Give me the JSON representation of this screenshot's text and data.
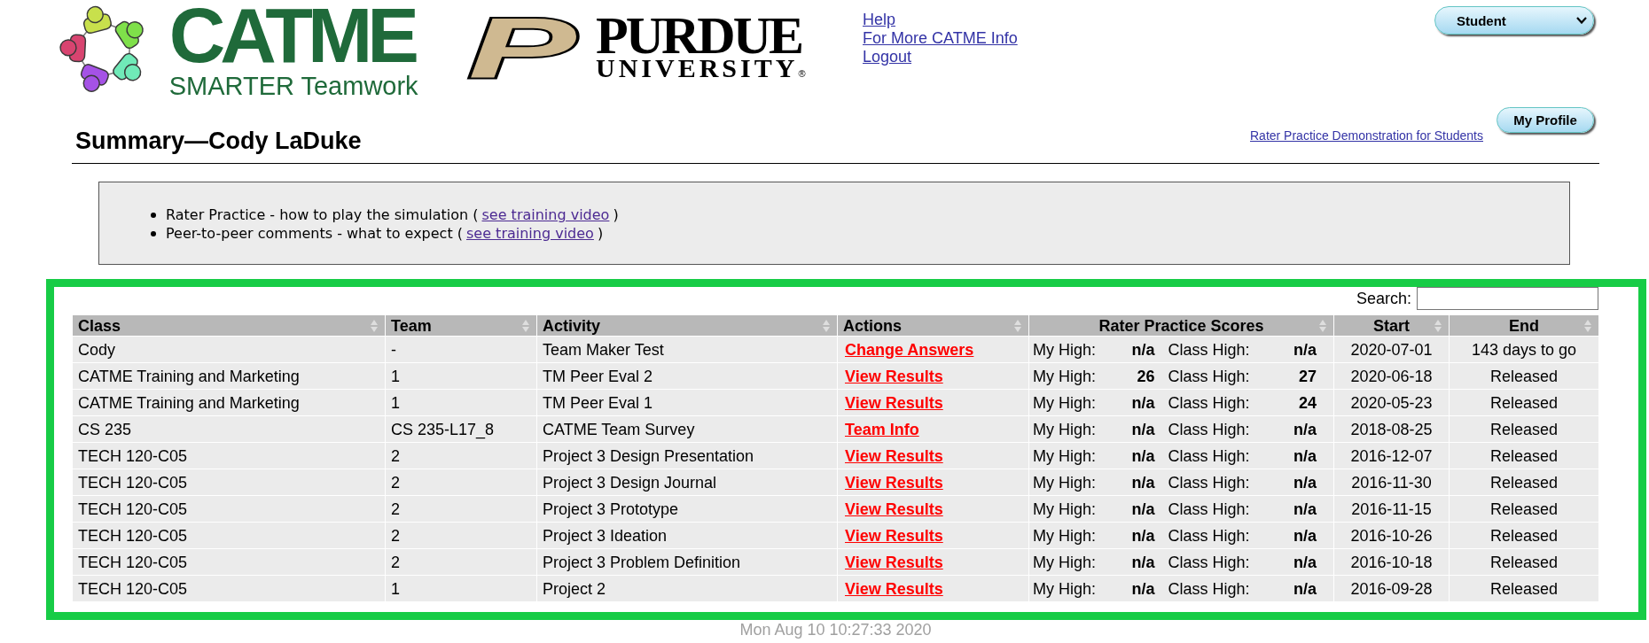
{
  "header": {
    "catme_logo": {
      "name": "CATME",
      "tagline": "SMARTER Teamwork"
    },
    "purdue_logo": {
      "mark": "P",
      "name": "PURDUE",
      "subtitle": "UNIVERSITY",
      "registered": "®"
    },
    "links": [
      "Help",
      "For More CATME Info",
      "Logout"
    ],
    "role_select": {
      "value": "Student"
    }
  },
  "page": {
    "title": "Summary—Cody LaDuke",
    "demo_link": "Rater Practice Demonstration for Students",
    "profile_button": "My Profile"
  },
  "info_box": {
    "items": [
      {
        "text": "Rater Practice - how to play the simulation (",
        "link": "see training video",
        "after": ")"
      },
      {
        "text": "Peer-to-peer comments - what to expect (",
        "link": "see training video",
        "after": ")"
      }
    ]
  },
  "search": {
    "label": "Search:"
  },
  "table": {
    "columns": [
      "Class",
      "Team",
      "Activity",
      "Actions",
      "Rater Practice Scores",
      "Start",
      "End"
    ],
    "rows": [
      {
        "class": "Cody",
        "team": "-",
        "activity": "Team Maker Test",
        "action": "Change Answers",
        "my_high_label": "My High:",
        "my_high": "n/a",
        "class_high_label": "Class High:",
        "class_high": "n/a",
        "start": "2020-07-01",
        "end": "143 days to go"
      },
      {
        "class": "CATME Training and Marketing",
        "team": "1",
        "activity": "TM Peer Eval 2",
        "action": "View Results",
        "my_high_label": "My High:",
        "my_high": "26",
        "class_high_label": "Class High:",
        "class_high": "27",
        "start": "2020-06-18",
        "end": "Released"
      },
      {
        "class": "CATME Training and Marketing",
        "team": "1",
        "activity": "TM Peer Eval 1",
        "action": "View Results",
        "my_high_label": "My High:",
        "my_high": "n/a",
        "class_high_label": "Class High:",
        "class_high": "24",
        "start": "2020-05-23",
        "end": "Released"
      },
      {
        "class": "CS 235",
        "team": "CS 235-L17_8",
        "activity": "CATME Team Survey",
        "action": "Team Info",
        "my_high_label": "My High:",
        "my_high": "n/a",
        "class_high_label": "Class High:",
        "class_high": "n/a",
        "start": "2018-08-25",
        "end": "Released"
      },
      {
        "class": "TECH 120-C05",
        "team": "2",
        "activity": "Project 3 Design Presentation",
        "action": "View Results",
        "my_high_label": "My High:",
        "my_high": "n/a",
        "class_high_label": "Class High:",
        "class_high": "n/a",
        "start": "2016-12-07",
        "end": "Released"
      },
      {
        "class": "TECH 120-C05",
        "team": "2",
        "activity": "Project 3 Design Journal",
        "action": "View Results",
        "my_high_label": "My High:",
        "my_high": "n/a",
        "class_high_label": "Class High:",
        "class_high": "n/a",
        "start": "2016-11-30",
        "end": "Released"
      },
      {
        "class": "TECH 120-C05",
        "team": "2",
        "activity": "Project 3 Prototype",
        "action": "View Results",
        "my_high_label": "My High:",
        "my_high": "n/a",
        "class_high_label": "Class High:",
        "class_high": "n/a",
        "start": "2016-11-15",
        "end": "Released"
      },
      {
        "class": "TECH 120-C05",
        "team": "2",
        "activity": "Project 3 Ideation",
        "action": "View Results",
        "my_high_label": "My High:",
        "my_high": "n/a",
        "class_high_label": "Class High:",
        "class_high": "n/a",
        "start": "2016-10-26",
        "end": "Released"
      },
      {
        "class": "TECH 120-C05",
        "team": "2",
        "activity": "Project 3 Problem Definition",
        "action": "View Results",
        "my_high_label": "My High:",
        "my_high": "n/a",
        "class_high_label": "Class High:",
        "class_high": "n/a",
        "start": "2016-10-18",
        "end": "Released"
      },
      {
        "class": "TECH 120-C05",
        "team": "1",
        "activity": "Project 2",
        "action": "View Results",
        "my_high_label": "My High:",
        "my_high": "n/a",
        "class_high_label": "Class High:",
        "class_high": "n/a",
        "start": "2016-09-28",
        "end": "Released"
      }
    ]
  },
  "footer": {
    "timestamp": "Mon Aug 10 10:27:33 2020"
  }
}
